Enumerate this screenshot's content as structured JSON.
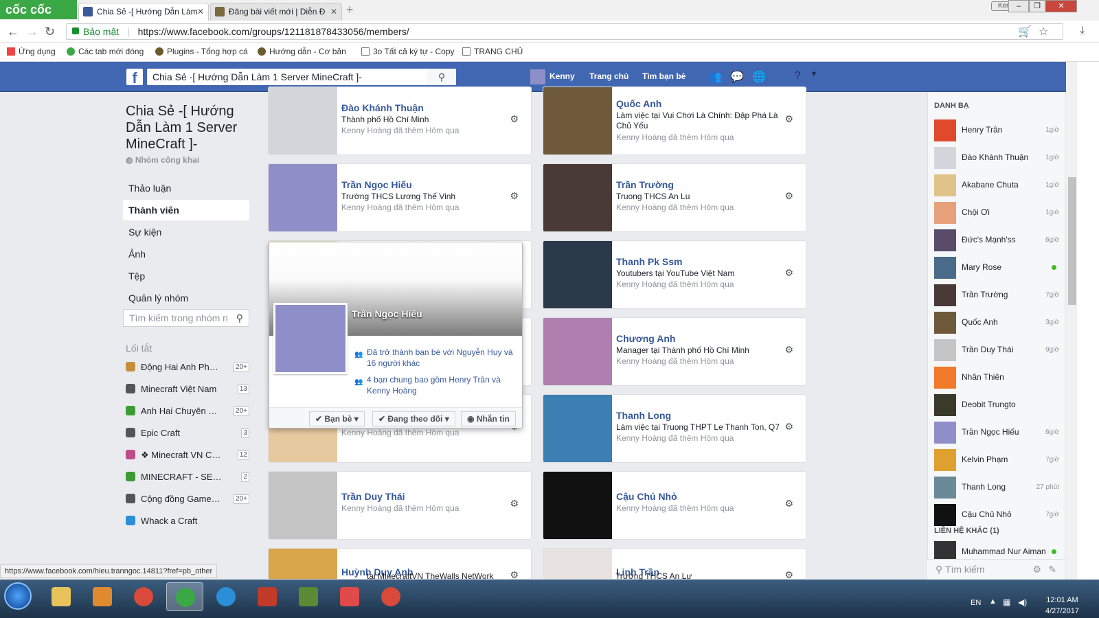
{
  "browser": {
    "brand": "cốc cốc",
    "tabs": [
      {
        "label": "Chia Sẻ -[ Hướng Dẫn Làm",
        "favicon_color": "#3b5998"
      },
      {
        "label": "Đăng bài viết mới | Diễn Đ",
        "favicon_color": "#7b6a3c"
      }
    ],
    "user": "Kenny",
    "address": {
      "security": "Bảo mật",
      "url": "https://www.facebook.com/groups/121181878433056/members/"
    },
    "bookmarks": [
      "Ứng dụng",
      "Các tab mới đóng",
      "Plugins - Tổng hợp cá",
      "Hướng dẫn - Cơ bản",
      "3o Tất cả ký tự - Copy",
      "TRANG CHỦ"
    ],
    "status_url": "https://www.facebook.com/hieu.tranngoc.14811?fref=pb_other"
  },
  "fb_header": {
    "search_value": "Chia Sẻ -[ Hướng Dẫn Làm 1 Server MineCraft ]-",
    "user_name": "Kenny",
    "nav": [
      "Trang chủ",
      "Tìm bạn bè"
    ]
  },
  "group": {
    "title": "Chia Sẻ -[ Hướng Dẫn Làm 1 Server MineCraft ]-",
    "type": "Nhóm công khai",
    "nav": [
      "Thảo luận",
      "Thành viên",
      "Sự kiện",
      "Ảnh",
      "Tệp",
      "Quản lý nhóm"
    ],
    "active_nav": "Thành viên",
    "search_placeholder": "Tìm kiếm trong nhóm n",
    "shortcuts_heading": "Lối tắt",
    "shortcuts": [
      {
        "label": "Động Hai Anh Phê ...",
        "count": "20+",
        "color": "#c58f3a"
      },
      {
        "label": "Minecraft Việt Nam",
        "count": "13",
        "color": "#555"
      },
      {
        "label": "Anh Hai Chuyên Cần",
        "count": "20+",
        "color": "#3d9b35"
      },
      {
        "label": "Epic Craft",
        "count": "3",
        "color": "#555"
      },
      {
        "label": "❖ Minecraft VN Co...",
        "count": "12",
        "color": "#c04a8c"
      },
      {
        "label": "MINECRAFT - SERV...",
        "count": "2",
        "color": "#3d9b35"
      },
      {
        "label": "Cộng đồng Game O...",
        "count": "20+",
        "color": "#555"
      },
      {
        "label": "Whack a Craft",
        "count": "",
        "color": "#2a8fd6"
      }
    ]
  },
  "members": [
    {
      "name": "Đào Khánh Thuận",
      "line1": "Thành phố Hồ Chí Minh",
      "line2": "Kenny Hoàng đã thêm Hôm qua",
      "photo_color": "#d3d6db"
    },
    {
      "name": "Quốc Anh",
      "line1": "Làm việc tại Vui Chơi Là Chính: Đập Phá Là Chủ Yếu",
      "line2": "Kenny Hoàng đã thêm Hôm qua",
      "photo_color": "#6e5a3a"
    },
    {
      "name": "Trần Ngọc Hiếu",
      "line1": "Trường THCS Lương Thế Vinh",
      "line2": "Kenny Hoàng đã thêm Hôm qua",
      "photo_color": "#8e8fc9"
    },
    {
      "name": "Trần Trường",
      "line1": "Truong THCS An Lu",
      "line2": "Kenny Hoàng đã thêm Hôm qua",
      "photo_color": "#4a3a36"
    },
    {
      "name": "",
      "line1": "",
      "line2": "",
      "photo_color": "#f0e2b4"
    },
    {
      "name": "Thanh Pk Ssm",
      "line1": "Youtubers tại YouTube Việt Nam",
      "line2": "Kenny Hoàng đã thêm Hôm qua",
      "photo_color": "#2b3a4a"
    },
    {
      "name": "",
      "line1": "",
      "line2": "",
      "photo_color": "#ffffff"
    },
    {
      "name": "Chương Anh",
      "line1": "Manager tại Thành phố Hồ Chí Minh",
      "line2": "Kenny Hoàng đã thêm Hôm qua",
      "photo_color": "#b07fb0"
    },
    {
      "name": "",
      "line1": "",
      "line2": "Kenny Hoàng đã thêm Hôm qua",
      "photo_color": "#e7c9a0"
    },
    {
      "name": "Thanh Long",
      "line1": "Làm việc tại Truong THPT Le Thanh Ton, Q7",
      "line2": "Kenny Hoàng đã thêm Hôm qua",
      "photo_color": "#3b7fb3"
    },
    {
      "name": "Trần Duy Thái",
      "line1": "Kenny Hoàng đã thêm Hôm qua",
      "line2": "",
      "photo_color": "#c5c5c5"
    },
    {
      "name": "Cậu Chủ Nhỏ",
      "line1": "Kenny Hoàng đã thêm Hôm qua",
      "line2": "",
      "photo_color": "#111111"
    },
    {
      "name": "Huỳnh Duy Anh",
      "line1": "tại MinecraftVN TheWalls NetWork",
      "line2": "",
      "photo_color": "#d9a54a"
    },
    {
      "name": "Linh Trần",
      "line1": "Trường THCS An Lư",
      "line2": "",
      "photo_color": "#e8e3e0"
    }
  ],
  "hovercard": {
    "name": "Trần Ngọc Hiếu",
    "friend_line": "Đã trở thành bạn bè với Nguyễn Huy và 16 người khác",
    "mutual_line": "4 bạn chung bao gồm Henry Trần và Kenny Hoàng",
    "buttons": [
      "✔ Bạn bè ▾",
      "✔ Đang theo dõi ▾",
      "Nhắn tin"
    ]
  },
  "chat": {
    "heading": "DANH BẠ",
    "contacts": [
      {
        "name": "Henry Trần",
        "time": "1giờ",
        "color": "#e04a2a"
      },
      {
        "name": "Đào Khánh Thuận",
        "time": "1giờ",
        "color": "#d3d6db"
      },
      {
        "name": "Akabane Chuta",
        "time": "1giờ",
        "color": "#e0c38a"
      },
      {
        "name": "Chội Ơi",
        "time": "1giờ",
        "color": "#e6a07a"
      },
      {
        "name": "Đức's Mạnh'ss",
        "time": "6giờ",
        "color": "#5a4a6a"
      },
      {
        "name": "Mary Rose",
        "time": "",
        "color": "#4a6a8a"
      },
      {
        "name": "Trần Trường",
        "time": "7giờ",
        "color": "#4a3a36"
      },
      {
        "name": "Quốc Anh",
        "time": "3giờ",
        "color": "#6e5a3a"
      },
      {
        "name": "Trần Duy Thái",
        "time": "9giờ",
        "color": "#c5c5c5"
      },
      {
        "name": "Nhân Thiên",
        "time": "",
        "color": "#f07a2a"
      },
      {
        "name": "Deobit Trungto",
        "time": "",
        "color": "#3a3a2a"
      },
      {
        "name": "Trần Ngọc Hiếu",
        "time": "6giờ",
        "color": "#8e8fc9"
      },
      {
        "name": "Kelvin Phạm",
        "time": "7giờ",
        "color": "#e0a030"
      },
      {
        "name": "Thanh Long",
        "time": "27 phút",
        "color": "#6a8a9a"
      },
      {
        "name": "Cậu Chủ Nhỏ",
        "time": "7giờ",
        "color": "#111111"
      }
    ],
    "online": [
      "Mary Rose"
    ],
    "other_heading": "LIÊN HỆ KHÁC (1)",
    "other_contact": "Muhammad Nur Aiman",
    "search_placeholder": "Tìm kiếm"
  },
  "taskbar": {
    "lang": "EN",
    "time": "12:01 AM",
    "date": "4/27/2017"
  }
}
